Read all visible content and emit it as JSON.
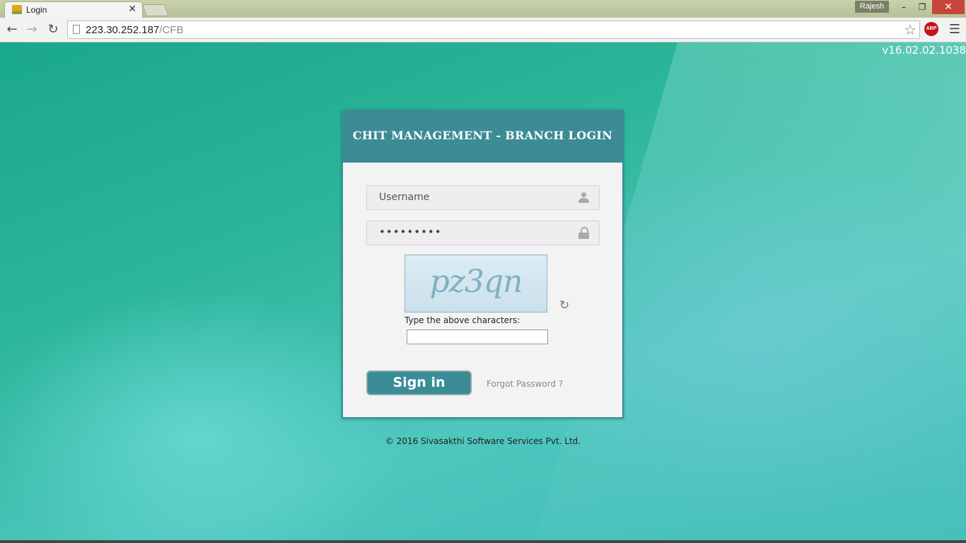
{
  "browser": {
    "tab_title": "Login",
    "tab_close": "✕",
    "profile_name": "Rajesh",
    "window_minimize": "–",
    "window_maximize": "❐",
    "window_close": "✕",
    "url_host": "223.30.252.187",
    "url_path": "/CFB",
    "abp_label": "ABP",
    "icons": {
      "back": "back-arrow-icon",
      "forward": "forward-arrow-icon",
      "reload": "reload-icon",
      "bookmark": "star-icon",
      "menu": "hamburger-menu-icon"
    }
  },
  "page": {
    "version": "v16.02.02.1038",
    "login": {
      "title": "CHIT MANAGEMENT - BRANCH LOGIN",
      "username_placeholder": "Username",
      "password_value": "•••••••••",
      "captcha_text": "pz3qn",
      "captcha_label": "Type the above characters:",
      "captcha_input_value": "",
      "signin_label": "Sign in",
      "forgot_label": "Forgot Password ?"
    },
    "copyright": "© 2016 Sivasakthi Software Services Pvt. Ltd.",
    "colors": {
      "header": "#3c8b95",
      "button": "#3a8d96",
      "background": "#1aa58c"
    }
  }
}
